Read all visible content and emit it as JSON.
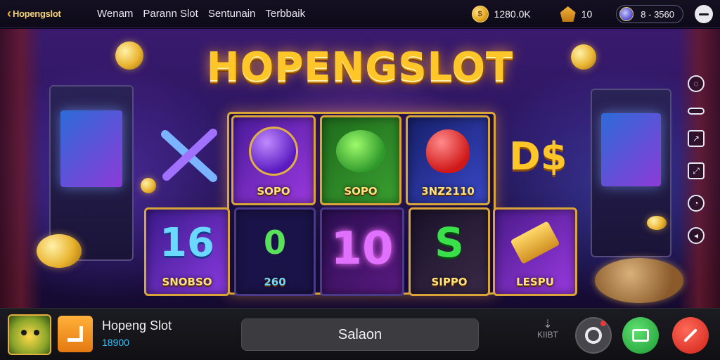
{
  "topbar": {
    "brand": "Hopengslot",
    "nav": [
      "Wenam",
      "Parann Slot",
      "Sentunain",
      "Terbbaik"
    ],
    "coins": "1280.0K",
    "bag": "10",
    "gems": "8 - 3560"
  },
  "stage": {
    "logo": "HOPENGSLOT",
    "side_symbol_right": "D$",
    "tiles": [
      {
        "label": "SOPO",
        "symbol": "",
        "color": "#7a30d0"
      },
      {
        "label": "SOPO",
        "symbol": "",
        "color": "#2f9a2c"
      },
      {
        "label": "3NZ2110",
        "symbol": "",
        "color": "#2030a0"
      },
      {
        "label": "SNOBSO",
        "symbol": "16",
        "color": "#5a2ab8"
      },
      {
        "label": "260",
        "symbol": "0",
        "color": "#1a1348"
      },
      {
        "label": "",
        "symbol": "10",
        "color": "#4a1470"
      },
      {
        "label": "SIPPO",
        "symbol": "S",
        "color": "#2a1a38"
      },
      {
        "label": "LESPU",
        "symbol": "",
        "color": "#6a20a8"
      }
    ]
  },
  "bottombar": {
    "game_name": "Hopeng Slot",
    "game_score": "18900",
    "action_label": "Salaon",
    "download_label": "KIIBT"
  },
  "colors": {
    "accent_gold": "#ffc62a",
    "score_blue": "#33c4ff",
    "green_button": "#1c9a33",
    "red_button": "#cf2016"
  }
}
